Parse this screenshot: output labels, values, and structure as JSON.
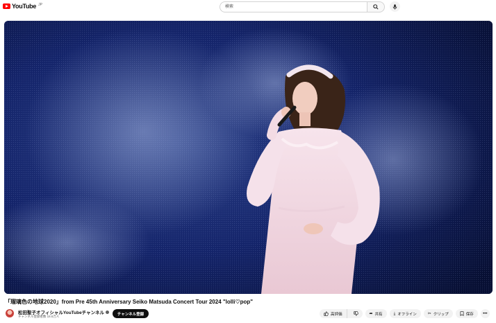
{
  "header": {
    "logo_text": "YouTube",
    "country_code": "JP",
    "search_placeholder": "検索"
  },
  "video": {
    "title": "「瑠璃色の地球2020」from Pre 45th Anniversary Seiko Matsuda Concert Tour 2024 \"lolli♡pop\""
  },
  "channel": {
    "name": "松田聖子オフィシャルYouTubeチャンネル",
    "subscribers": "チャンネル登録者数 18.6万人",
    "subscribe_label": "チャンネル登録"
  },
  "actions": {
    "like_label": "高評価",
    "share_label": "共有",
    "offline_label": "オフライン",
    "clip_label": "クリップ",
    "save_label": "保存"
  },
  "colors": {
    "brand_red": "#ff0000",
    "subscribe_bg": "#0f0f0f",
    "pill_bg": "#f2f2f2"
  },
  "icons": [
    "youtube-logo-icon",
    "search-icon",
    "mic-icon",
    "like-icon",
    "dislike-icon",
    "share-icon",
    "download-icon",
    "scissors-icon",
    "bookmark-icon",
    "more-icon",
    "verified-icon"
  ]
}
